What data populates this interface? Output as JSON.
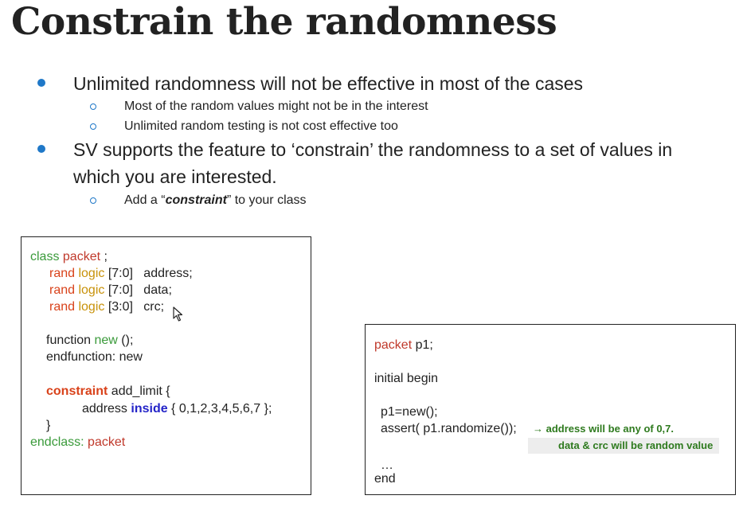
{
  "title": "Constrain the randomness",
  "bullets": {
    "b1": "Unlimited randomness will not be effective in most of the cases",
    "b1_sub1": "Most of the random values  might not be in the interest",
    "b1_sub2": "Unlimited random testing is not cost effective too",
    "b2_line1": "SV supports the feature to ‘constrain’ the randomness to a set of values in",
    "b2_line2": "which you are interested.",
    "b2_sub1_pre": "Add a “",
    "b2_sub1_em": "constraint",
    "b2_sub1_post": "” to your class"
  },
  "code_left": {
    "l1_kw": "class",
    "l1_name": " packet",
    "l1_end": " ;",
    "l2_rand": "rand",
    "l2_logic": " logic",
    "l2_rest": " [7:0]   address;",
    "l3_rand": "rand",
    "l3_logic": " logic",
    "l3_rest": " [7:0]   data;",
    "l4_rand": "rand",
    "l4_logic": " logic",
    "l4_rest": " [3:0]   crc;",
    "l5_a": "function ",
    "l5_new": "new",
    "l5_b": " ();",
    "l6": "endfunction: new",
    "l7_kw": "constraint",
    "l7_rest": " add_limit {",
    "l8_a": "address ",
    "l8_kw": "inside",
    "l8_b": " { 0,1,2,3,4,5,6,7 };",
    "l9": "}",
    "l10_kw": "endclass:",
    "l10_name": " packet"
  },
  "code_right": {
    "l1_kw": "packet",
    "l1_rest": " p1;",
    "l2": "initial begin",
    "l3": "p1=new();",
    "l4": "assert( p1.randomize());",
    "note1": "→  address will be any of 0,7.",
    "note2": "data & crc will be random value",
    "l5": "…",
    "l6": "end"
  },
  "colors": {
    "bullet": "#1f78c8",
    "keyword_green": "#3a9a3a",
    "keyword_red": "#d9421a",
    "keyword_gold": "#c8920a",
    "keyword_blue": "#2424c8",
    "note_green": "#2e7a1e"
  },
  "icons": {
    "cursor": "mouse-pointer-icon"
  }
}
